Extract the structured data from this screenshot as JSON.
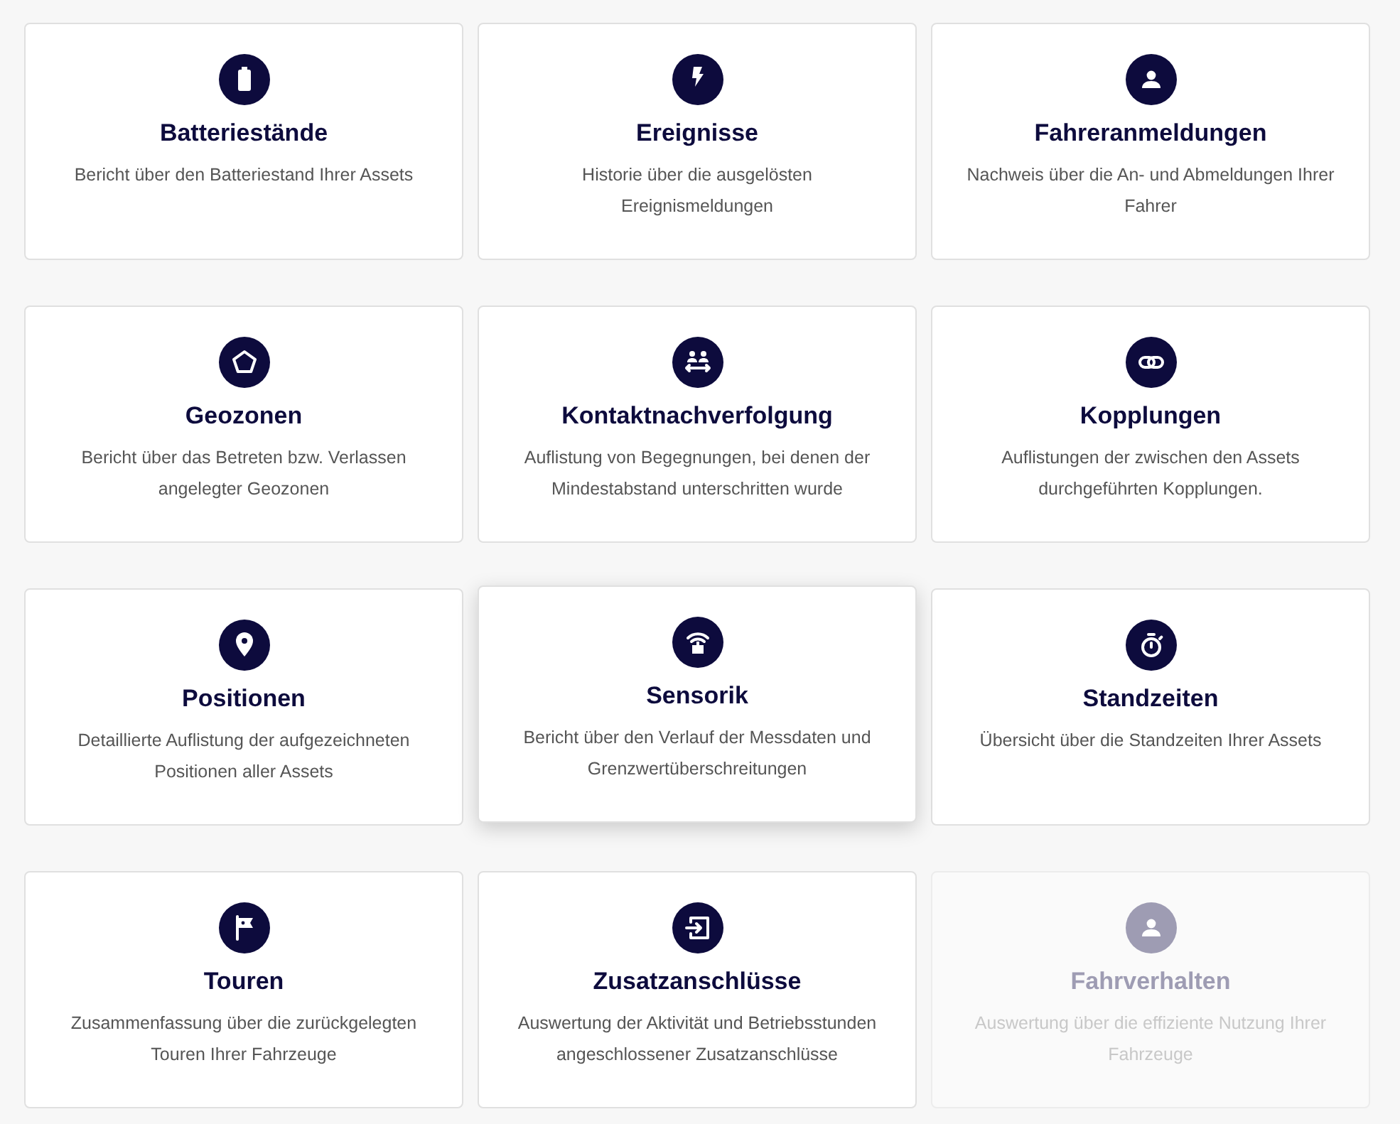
{
  "cards": [
    {
      "kind": "battery",
      "title": "Batteriestände",
      "description": "Bericht über den Batteriestand Ihrer Assets",
      "disabled": false,
      "highlighted": false
    },
    {
      "kind": "bolt",
      "title": "Ereignisse",
      "description": "Historie über die ausgelösten Ereignismeldungen",
      "disabled": false,
      "highlighted": false
    },
    {
      "kind": "person",
      "title": "Fahreranmeldungen",
      "description": "Nachweis über die An- und Abmeldungen Ihrer Fahrer",
      "disabled": false,
      "highlighted": false
    },
    {
      "kind": "pentagon",
      "title": "Geozonen",
      "description": "Bericht über das Betreten bzw. Verlassen angelegter Geozonen",
      "disabled": false,
      "highlighted": false
    },
    {
      "kind": "contacts",
      "title": "Kontaktnachverfolgung",
      "description": "Auflistung von Begegnungen, bei denen der Mindestabstand unterschritten wurde",
      "disabled": false,
      "highlighted": false
    },
    {
      "kind": "link",
      "title": "Kopplungen",
      "description": "Auflistungen der zwischen den Assets durchgeführten Kopplungen.",
      "disabled": false,
      "highlighted": false
    },
    {
      "kind": "pin",
      "title": "Positionen",
      "description": "Detaillierte Auflistung der aufgezeichneten Positionen aller Assets",
      "disabled": false,
      "highlighted": false
    },
    {
      "kind": "sensor",
      "title": "Sensorik",
      "description": "Bericht über den Verlauf der Messdaten und Grenzwertüberschreitungen",
      "disabled": false,
      "highlighted": true
    },
    {
      "kind": "timer",
      "title": "Standzeiten",
      "description": "Übersicht über die Standzeiten Ihrer Assets",
      "disabled": false,
      "highlighted": false
    },
    {
      "kind": "flag",
      "title": "Touren",
      "description": "Zusammenfassung über die zurückgelegten Touren Ihrer Fahrzeuge",
      "disabled": false,
      "highlighted": false
    },
    {
      "kind": "input",
      "title": "Zusatzanschlüsse",
      "description": "Auswertung der Aktivität und Betriebsstunden angeschlossener Zusatzanschlüsse",
      "disabled": false,
      "highlighted": false
    },
    {
      "kind": "person",
      "title": "Fahrverhalten",
      "description": "Auswertung über die effiziente Nutzung Ihrer Fahrzeuge",
      "disabled": true,
      "highlighted": false
    }
  ]
}
